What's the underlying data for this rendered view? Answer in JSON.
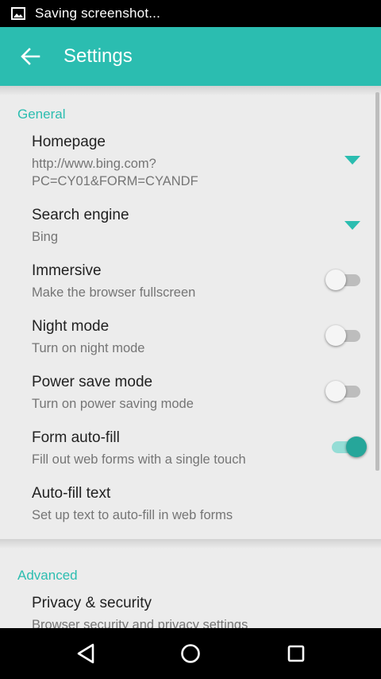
{
  "status_bar": {
    "notification_text": "Saving screenshot..."
  },
  "app_bar": {
    "title": "Settings",
    "back_icon": "arrow-back-icon",
    "color": "#2bbdb0"
  },
  "sections": {
    "general": {
      "header": "General",
      "items": [
        {
          "title": "Homepage",
          "summary_line1": "http://www.bing.com?",
          "summary_line2": "PC=CY01&FORM=CYANDF",
          "control": "dropdown"
        },
        {
          "title": "Search engine",
          "summary": "Bing",
          "control": "dropdown"
        },
        {
          "title": "Immersive",
          "summary": "Make the browser fullscreen",
          "control": "switch",
          "checked": false
        },
        {
          "title": "Night mode",
          "summary": "Turn on night mode",
          "control": "switch",
          "checked": false
        },
        {
          "title": "Power save mode",
          "summary": "Turn on power saving mode",
          "control": "switch",
          "checked": false
        },
        {
          "title": "Form auto-fill",
          "summary": "Fill out web forms with a single touch",
          "control": "switch",
          "checked": true
        },
        {
          "title": "Auto-fill text",
          "summary": "Set up text to auto-fill in web forms",
          "control": "none"
        }
      ]
    },
    "advanced": {
      "header": "Advanced",
      "items": [
        {
          "title": "Privacy & security",
          "summary": "Browser security and privacy settings"
        }
      ]
    }
  },
  "nav_bar": {
    "buttons": [
      "back-triangle-icon",
      "home-circle-icon",
      "recents-square-icon"
    ]
  }
}
